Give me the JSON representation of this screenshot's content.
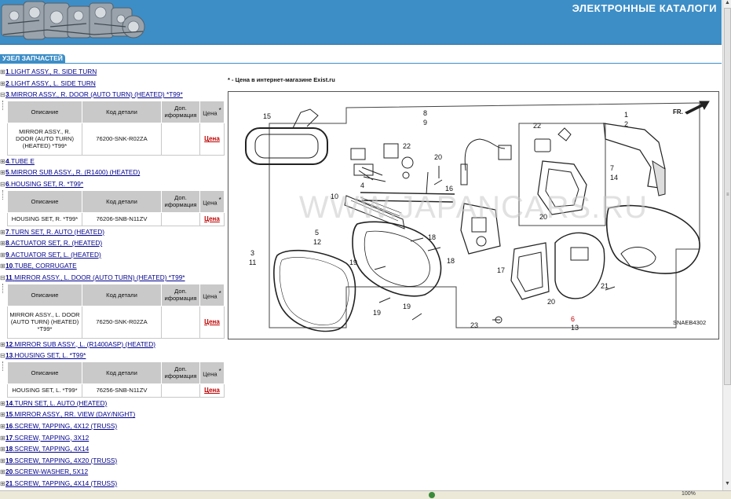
{
  "header": {
    "title": "ЭЛЕКТРОННЫЕ КАТАЛОГИ"
  },
  "section": {
    "tab_label": "УЗЕЛ ЗАПЧАСТЕЙ"
  },
  "price_note": "* - Цена в интернет-магазине Exist.ru",
  "columns": {
    "desc": "Описание",
    "code": "Код детали",
    "info": "Доп. иформация",
    "price": "Цена",
    "star": "*"
  },
  "parts": [
    {
      "num": "1",
      "name": "LIGHT ASSY., R. SIDE TURN"
    },
    {
      "num": "2",
      "name": "LIGHT ASSY., L. SIDE TURN"
    },
    {
      "num": "3",
      "name": "MIRROR ASSY., R. DOOR (AUTO TURN) (HEATED) *T99*"
    },
    {
      "num": "4",
      "name": "TUBE E"
    },
    {
      "num": "5",
      "name": "MIRROR SUB ASSY., R. (R1400) (HEATED)"
    },
    {
      "num": "6",
      "name": "HOUSING SET, R. *T99*"
    },
    {
      "num": "7",
      "name": "TURN SET, R. AUTO (HEATED)"
    },
    {
      "num": "8",
      "name": "ACTUATOR SET, R. (HEATED)"
    },
    {
      "num": "9",
      "name": "ACTUATOR SET, L. (HEATED)"
    },
    {
      "num": "10",
      "name": "TUBE, CORRUGATE"
    },
    {
      "num": "11",
      "name": "MIRROR ASSY., L. DOOR (AUTO TURN) (HEATED) *T99*"
    },
    {
      "num": "12",
      "name": "MIRROR SUB ASSY., L. (R1400ASP) (HEATED)"
    },
    {
      "num": "13",
      "name": "HOUSING SET, L. *T99*"
    },
    {
      "num": "14",
      "name": "TURN SET, L. AUTO (HEATED)"
    },
    {
      "num": "15",
      "name": "MIRROR ASSY., RR. VIEW (DAY/NIGHT)"
    },
    {
      "num": "16",
      "name": "SCREW, TAPPING, 4X12 (TRUSS)"
    },
    {
      "num": "17",
      "name": "SCREW, TAPPING, 3X12"
    },
    {
      "num": "18",
      "name": "SCREW, TAPPING, 4X14"
    },
    {
      "num": "19",
      "name": "SCREW, TAPPING, 4X20 (TRUSS)"
    },
    {
      "num": "20",
      "name": "SCREW-WASHER, 5X12"
    },
    {
      "num": "21",
      "name": "SCREW, TAPPING, 4X14 (TRUSS)"
    }
  ],
  "details": {
    "p3": {
      "desc": "MIRROR ASSY., R. DOOR (AUTO TURN) (HEATED) *T99*",
      "code": "76200-SNK-R02ZA",
      "price_link": "Цена"
    },
    "p6": {
      "desc": "HOUSING SET, R. *T99*",
      "code": "76206-SNB-N11ZV",
      "price_link": "Цена"
    },
    "p11": {
      "desc": "MIRROR ASSY., L. DOOR (AUTO TURN) (HEATED) *T99*",
      "code": "76250-SNK-R02ZA",
      "price_link": "Цена"
    },
    "p13": {
      "desc": "HOUSING SET, L. *T99*",
      "code": "76256-SNB-N11ZV",
      "price_link": "Цена"
    }
  },
  "diagram": {
    "watermark": "WWW.JAPANCARS.RU",
    "code": "SNAEB4302",
    "direction": "FR.",
    "callouts": [
      "15",
      "8",
      "9",
      "22",
      "20",
      "16",
      "4",
      "10",
      "5",
      "12",
      "18",
      "18",
      "3",
      "11",
      "19",
      "19",
      "19",
      "22",
      "20",
      "1",
      "2",
      "7",
      "14",
      "17",
      "20",
      "21",
      "23",
      "6",
      "13"
    ]
  },
  "status": {
    "zoom": "100%"
  }
}
